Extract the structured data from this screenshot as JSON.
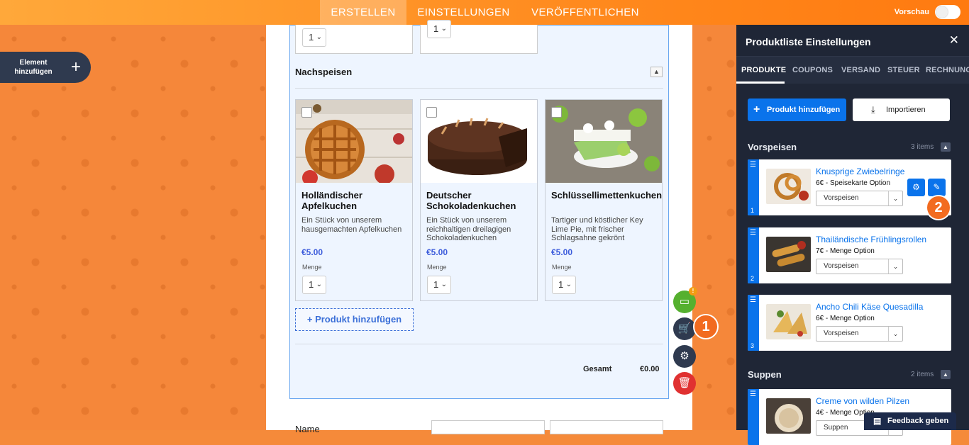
{
  "topbar": {
    "tabs": [
      "ERSTELLEN",
      "EINSTELLUNGEN",
      "VERÖFFENTLICHEN"
    ],
    "preview_label": "Vorschau"
  },
  "sidebar": {
    "add_element_label": "Element hinzufügen"
  },
  "form": {
    "top_qty": [
      "1",
      "1"
    ],
    "category": "Nachspeisen",
    "products": [
      {
        "name": "Holländischer Apfelkuchen",
        "desc": "Ein Stück von unserem hausgemachten Apfelkuchen",
        "price": "€5.00",
        "qty_label": "Menge",
        "qty": "1"
      },
      {
        "name": "Deutscher Schokoladenkuchen",
        "desc": "Ein Stück von unserem reichhaltigen dreilagigen Schokoladenkuchen",
        "price": "€5.00",
        "qty_label": "Menge",
        "qty": "1"
      },
      {
        "name": "Schlüssellimettenkuchen",
        "desc": "Tartiger und köstlicher Key Lime Pie, mit frischer Schlagsahne gekrönt",
        "price": "€5.00",
        "qty_label": "Menge",
        "qty": "1"
      }
    ],
    "add_product_label": "+ Produkt hinzufügen",
    "total_label": "Gesamt",
    "total_value": "€0.00",
    "name_label": "Name"
  },
  "badges": {
    "cart": "1",
    "edit": "2"
  },
  "panel": {
    "title": "Produktliste Einstellungen",
    "tabs": [
      "PRODUKTE",
      "COUPONS",
      "VERSAND",
      "STEUER",
      "RECHNUNG"
    ],
    "add_button": "Produkt hinzufügen",
    "import_button": "Importieren",
    "groups": [
      {
        "name": "Vorspeisen",
        "count": "3 items",
        "items": [
          {
            "name": "Knusprige Zwiebelringe",
            "option": "6€ - Speisekarte Option",
            "category": "Vorspeisen",
            "index": "1"
          },
          {
            "name": "Thailändische Frühlingsrollen",
            "option": "7€ - Menge Option",
            "category": "Vorspeisen",
            "index": "2"
          },
          {
            "name": "Ancho Chili Käse Quesadilla",
            "option": "6€ - Menge Option",
            "category": "Vorspeisen",
            "index": "3"
          }
        ]
      },
      {
        "name": "Suppen",
        "count": "2 items",
        "items": [
          {
            "name": "Creme von wilden Pilzen",
            "option": "4€ - Menge Option",
            "category": "Suppen"
          }
        ]
      }
    ]
  },
  "feedback_label": "Feedback geben",
  "colors": {
    "accent_orange": "#ff8a1e",
    "primary_blue": "#0a73eb",
    "panel_bg": "#1f2636"
  }
}
